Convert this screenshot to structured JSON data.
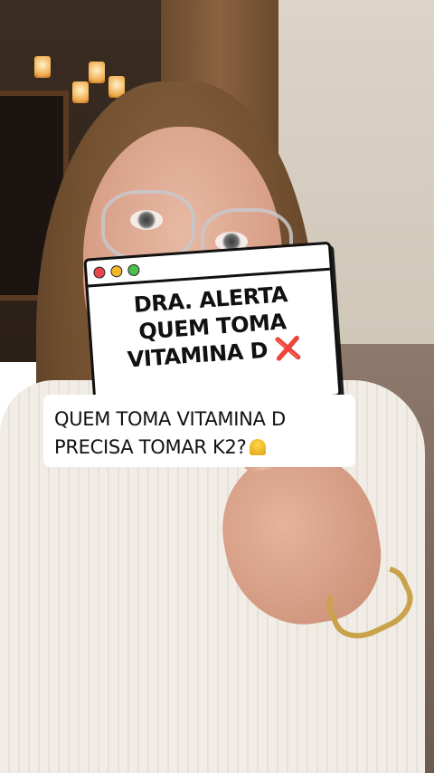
{
  "overlay_card": {
    "line1": "DRA. ALERTA",
    "line2": "QUEM TOMA",
    "line3": "VITAMINA D",
    "cross_symbol": "❌",
    "window_dots": [
      "#e5474a",
      "#f1b72d",
      "#4cc04e"
    ]
  },
  "caption": {
    "line1": "QUEM TOMA VITAMINA D",
    "line2": "PRECISA TOMAR K2?",
    "emoji_name": "bell-icon"
  },
  "colors": {
    "card_bg": "#ffffff",
    "card_border": "#111111",
    "cross": "#e0202a"
  }
}
